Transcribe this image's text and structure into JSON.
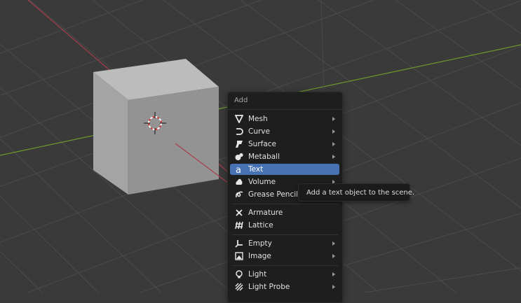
{
  "colors": {
    "viewport_bg": "#3a3a3a",
    "grid_line": "#4b4b4b",
    "x_axis": "#a83e4a",
    "y_axis": "#6a9a2a",
    "cube_light": "#bcbcbc",
    "cube_mid": "#a4a4a4",
    "cube_dark": "#939393",
    "menu_bg": "#1e1e1e",
    "highlight": "#4772b3",
    "text": "#e0e0e0"
  },
  "menu": {
    "title": "Add",
    "items": [
      {
        "label": "Mesh",
        "icon": "mesh-icon",
        "has_submenu": true
      },
      {
        "label": "Curve",
        "icon": "curve-icon",
        "has_submenu": true
      },
      {
        "label": "Surface",
        "icon": "surface-icon",
        "has_submenu": true
      },
      {
        "label": "Metaball",
        "icon": "metaball-icon",
        "has_submenu": true
      },
      {
        "label": "Text",
        "icon": "text-icon",
        "has_submenu": false,
        "active": true
      },
      {
        "label": "Volume",
        "icon": "volume-icon",
        "has_submenu": true
      },
      {
        "label": "Grease Pencil",
        "icon": "grease-pencil-icon",
        "has_submenu": true
      },
      {
        "label": "Armature",
        "icon": "armature-icon",
        "has_submenu": false
      },
      {
        "label": "Lattice",
        "icon": "lattice-icon",
        "has_submenu": false
      },
      {
        "label": "Empty",
        "icon": "empty-icon",
        "has_submenu": true
      },
      {
        "label": "Image",
        "icon": "image-icon",
        "has_submenu": true
      },
      {
        "label": "Light",
        "icon": "light-icon",
        "has_submenu": true
      },
      {
        "label": "Light Probe",
        "icon": "light-probe-icon",
        "has_submenu": true
      }
    ]
  },
  "tooltip": {
    "text": "Add a text object to the scene."
  }
}
